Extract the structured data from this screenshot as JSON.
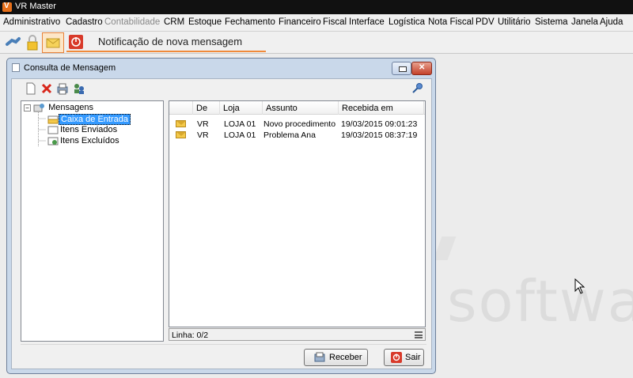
{
  "app": {
    "title": "VR Master"
  },
  "menu": [
    {
      "label": "Administrativo",
      "disabled": false
    },
    {
      "label": "Cadastro",
      "disabled": false
    },
    {
      "label": "Contabilidade",
      "disabled": true
    },
    {
      "label": "CRM",
      "disabled": false
    },
    {
      "label": "Estoque",
      "disabled": false
    },
    {
      "label": "Fechamento",
      "disabled": false
    },
    {
      "label": "Financeiro",
      "disabled": false
    },
    {
      "label": "Fiscal",
      "disabled": false
    },
    {
      "label": "Interface",
      "disabled": false
    },
    {
      "label": "Logística",
      "disabled": false
    },
    {
      "label": "Nota Fiscal",
      "disabled": false
    },
    {
      "label": "PDV",
      "disabled": false
    },
    {
      "label": "Utilitário",
      "disabled": false
    },
    {
      "label": "Sistema",
      "disabled": false
    },
    {
      "label": "Janela",
      "disabled": false
    },
    {
      "label": "Ajuda",
      "disabled": false
    }
  ],
  "toolbar": {
    "notification_text": "Notificação de nova mensagem",
    "icons": [
      "link-icon",
      "lock-icon",
      "envelope-icon",
      "power-icon"
    ]
  },
  "desktop": {
    "watermark": "softwa"
  },
  "dialog": {
    "title": "Consulta de Mensagem",
    "tools": [
      "new-document-icon",
      "delete-icon",
      "print-icon",
      "users-icon"
    ],
    "tree": {
      "root": "Mensagens",
      "items": [
        {
          "label": "Caixa de Entrada",
          "selected": true
        },
        {
          "label": "Itens Enviados",
          "selected": false
        },
        {
          "label": "Itens Excluídos",
          "selected": false
        }
      ]
    },
    "table": {
      "columns": [
        "De",
        "Loja",
        "Assunto",
        "Recebida em"
      ],
      "rows": [
        {
          "de": "VR",
          "loja": "LOJA 01",
          "assunto": "Novo procedimento",
          "recebida": "19/03/2015 09:01:23"
        },
        {
          "de": "VR",
          "loja": "LOJA 01",
          "assunto": "Problema Ana",
          "recebida": "19/03/2015 08:37:19"
        }
      ]
    },
    "status": "Linha: 0/2",
    "buttons": {
      "receive": "Receber",
      "exit": "Sair"
    }
  },
  "colors": {
    "accent": "#f08a3a",
    "selection": "#3399ff",
    "titlebar": "#111111"
  }
}
